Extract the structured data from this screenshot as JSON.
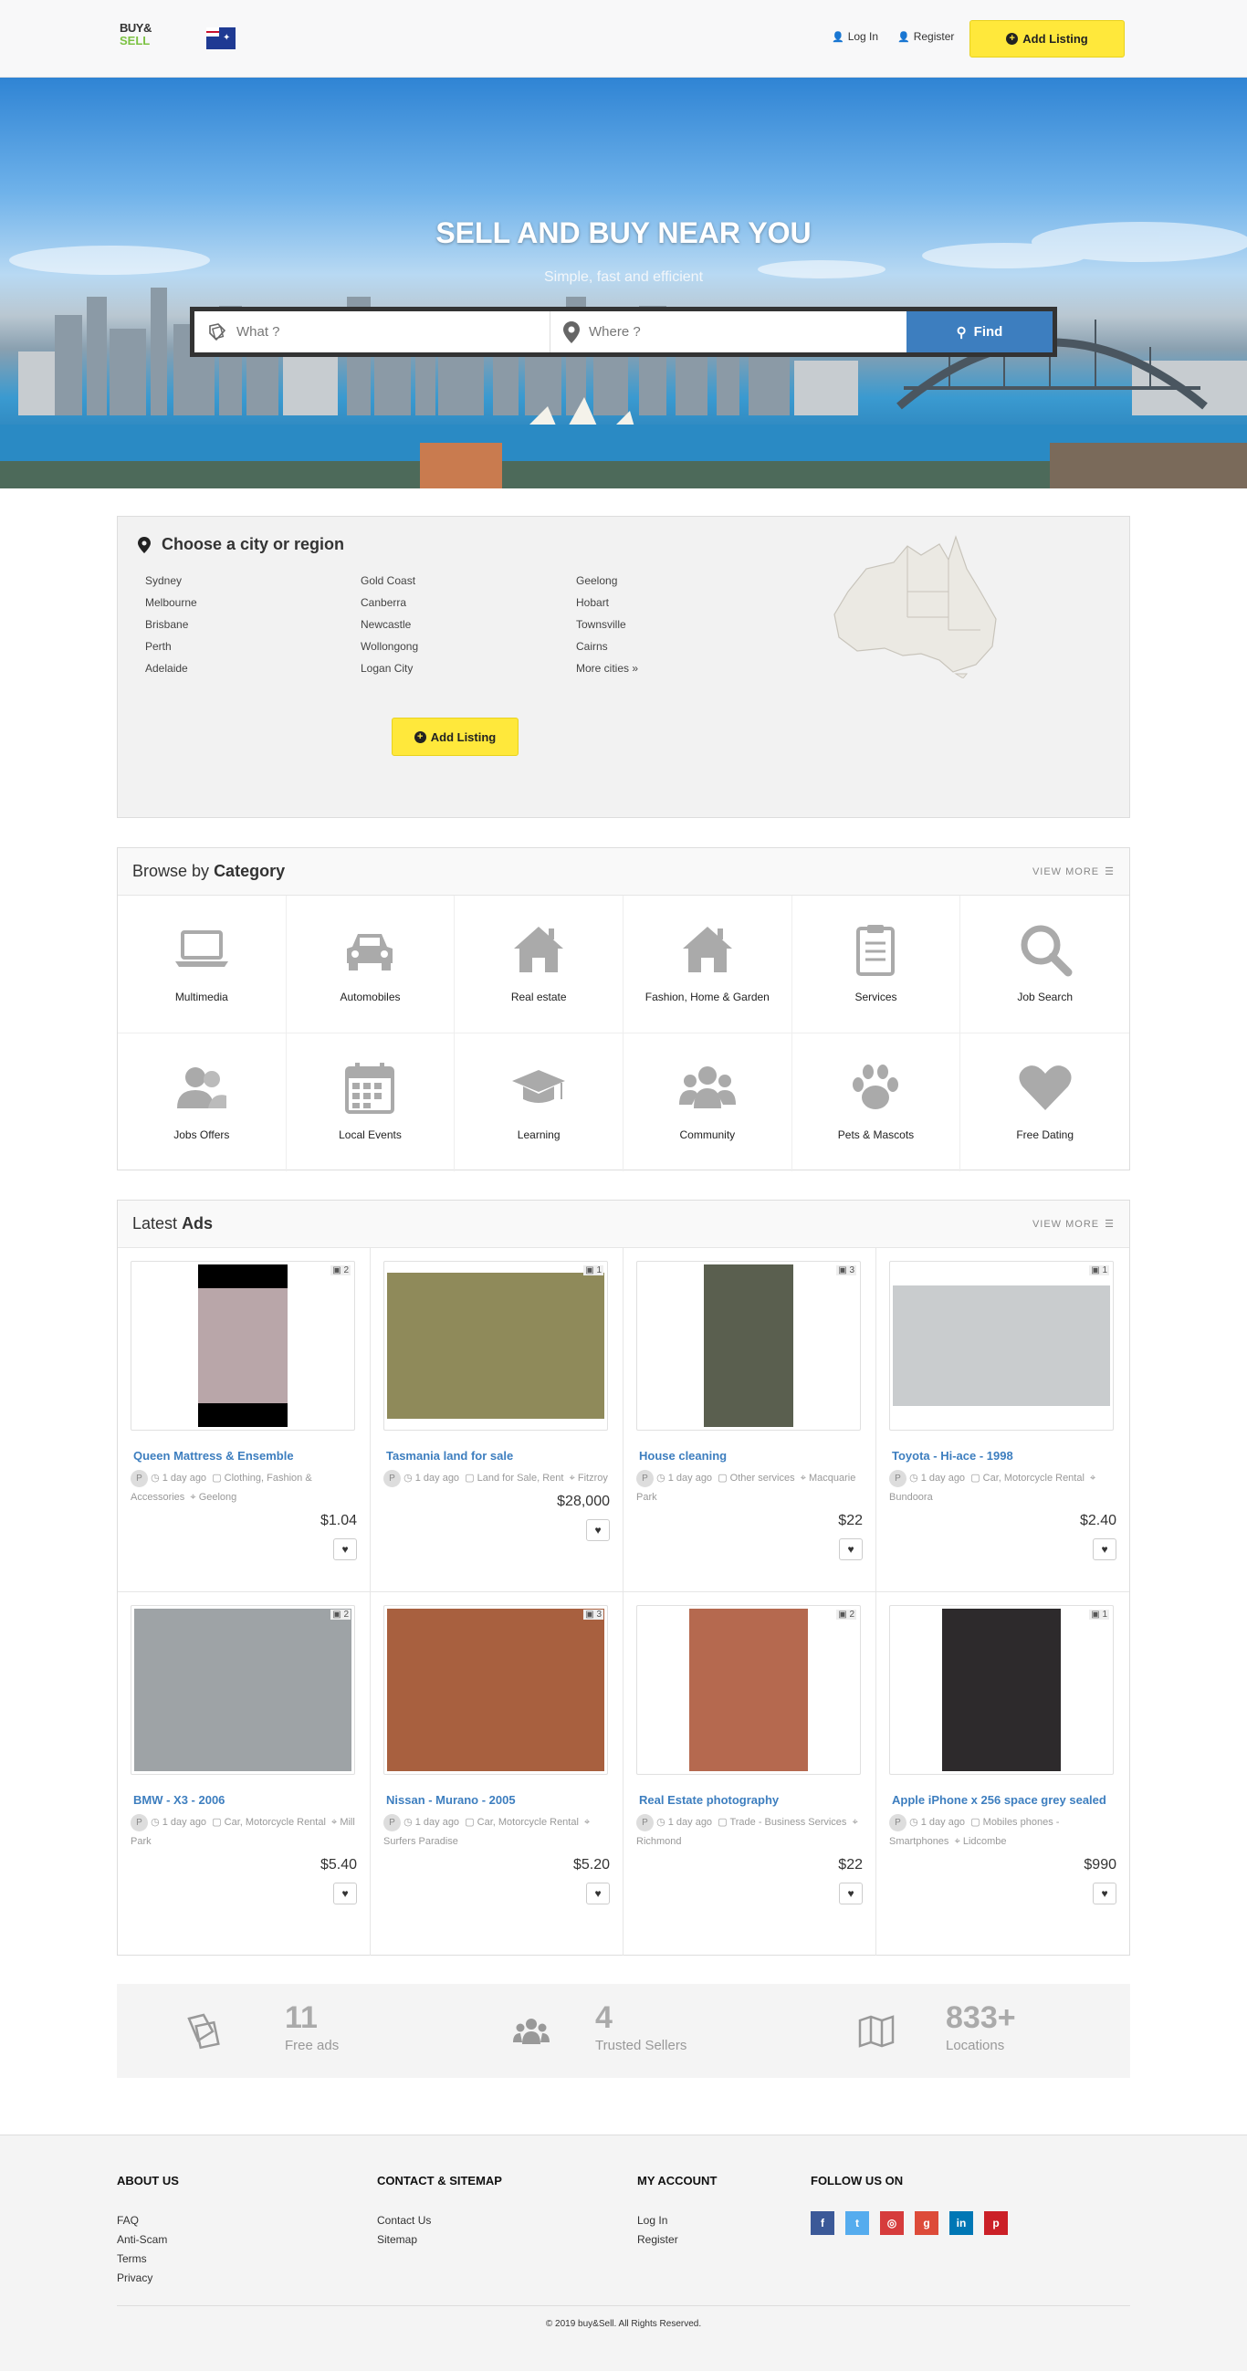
{
  "header": {
    "logo_top": "BUY&",
    "logo_bottom": "SELL",
    "login": "Log In",
    "register": "Register",
    "add_listing": "Add Listing"
  },
  "hero": {
    "title": "SELL AND BUY NEAR YOU",
    "subtitle": "Simple, fast and efficient",
    "what_placeholder": "What ?",
    "where_placeholder": "Where ?",
    "find": "Find"
  },
  "city": {
    "title": "Choose a city or region",
    "col1": [
      "Sydney",
      "Melbourne",
      "Brisbane",
      "Perth",
      "Adelaide"
    ],
    "col2": [
      "Gold Coast",
      "Canberra",
      "Newcastle",
      "Wollongong",
      "Logan City"
    ],
    "col3": [
      "Geelong",
      "Hobart",
      "Townsville",
      "Cairns",
      "More cities »"
    ],
    "add_listing": "Add Listing"
  },
  "categories": {
    "title_pre": "Browse by",
    "title_bold": "Category",
    "view_more": "VIEW MORE",
    "items": [
      {
        "label": "Multimedia",
        "icon": "laptop-icon"
      },
      {
        "label": "Automobiles",
        "icon": "car-icon"
      },
      {
        "label": "Real estate",
        "icon": "home-icon"
      },
      {
        "label": "Fashion, Home & Garden",
        "icon": "home-icon"
      },
      {
        "label": "Services",
        "icon": "clipboard-icon"
      },
      {
        "label": "Job Search",
        "icon": "search-icon"
      },
      {
        "label": "Jobs Offers",
        "icon": "users-icon"
      },
      {
        "label": "Local Events",
        "icon": "calendar-icon"
      },
      {
        "label": "Learning",
        "icon": "graduation-cap-icon"
      },
      {
        "label": "Community",
        "icon": "group-icon"
      },
      {
        "label": "Pets & Mascots",
        "icon": "paw-icon"
      },
      {
        "label": "Free Dating",
        "icon": "heart-icon"
      }
    ]
  },
  "ads": {
    "title_pre": "Latest",
    "title_bold": "Ads",
    "view_more": "VIEW MORE",
    "items": [
      {
        "title": "Queen Mattress & Ensemble",
        "time": "1 day ago",
        "category": "Clothing, Fashion & Accessories",
        "location": "Geelong",
        "price": "$1.04",
        "photos": "2",
        "thumb_color": "#b9a6a9"
      },
      {
        "title": "Tasmania land for sale",
        "time": "1 day ago",
        "category": "Land for Sale, Rent",
        "location": "Fitzroy",
        "price": "$28,000",
        "photos": "1",
        "thumb_color": "#8f8a5a"
      },
      {
        "title": "House cleaning",
        "time": "1 day ago",
        "category": "Other services",
        "location": "Macquarie Park",
        "price": "$22",
        "photos": "3",
        "thumb_color": "#5a5f4f"
      },
      {
        "title": "Toyota - Hi-ace - 1998",
        "time": "1 day ago",
        "category": "Car, Motorcycle Rental",
        "location": "Bundoora",
        "price": "$2.40",
        "photos": "1",
        "thumb_color": "#c9ccce"
      },
      {
        "title": "BMW - X3 - 2006",
        "time": "1 day ago",
        "category": "Car, Motorcycle Rental",
        "location": "Mill Park",
        "price": "$5.40",
        "photos": "2",
        "thumb_color": "#9ea3a6"
      },
      {
        "title": "Nissan - Murano - 2005",
        "time": "1 day ago",
        "category": "Car, Motorcycle Rental",
        "location": "Surfers Paradise",
        "price": "$5.20",
        "photos": "3",
        "thumb_color": "#a8603f"
      },
      {
        "title": "Real Estate photography",
        "time": "1 day ago",
        "category": "Trade - Business Services",
        "location": "Richmond",
        "price": "$22",
        "photos": "2",
        "thumb_color": "#b5694f"
      },
      {
        "title": "Apple iPhone x 256 space grey sealed",
        "time": "1 day ago",
        "category": "Mobiles phones - Smartphones",
        "location": "Lidcombe",
        "price": "$990",
        "photos": "1",
        "thumb_color": "#2d2a2c"
      }
    ]
  },
  "stats": [
    {
      "number": "11",
      "label": "Free ads",
      "icon": "tags-icon"
    },
    {
      "number": "4",
      "label": "Trusted Sellers",
      "icon": "group-icon"
    },
    {
      "number": "833+",
      "label": "Locations",
      "icon": "map-icon"
    }
  ],
  "footer": {
    "about_title": "ABOUT US",
    "about_links": [
      "FAQ",
      "Anti-Scam",
      "Terms",
      "Privacy"
    ],
    "contact_title": "CONTACT & SITEMAP",
    "contact_links": [
      "Contact Us",
      "Sitemap"
    ],
    "account_title": "MY ACCOUNT",
    "account_links": [
      "Log In",
      "Register"
    ],
    "follow_title": "FOLLOW US ON",
    "social": [
      {
        "name": "facebook",
        "glyph": "f",
        "color": "#3b5998"
      },
      {
        "name": "twitter",
        "glyph": "t",
        "color": "#55acee"
      },
      {
        "name": "instagram",
        "glyph": "◎",
        "color": "#d63c3c"
      },
      {
        "name": "google-plus",
        "glyph": "g",
        "color": "#dd4b39"
      },
      {
        "name": "linkedin",
        "glyph": "in",
        "color": "#0077b5"
      },
      {
        "name": "pinterest",
        "glyph": "p",
        "color": "#cb2027"
      }
    ],
    "copyright": "© 2019 buy&Sell. All Rights Reserved."
  }
}
